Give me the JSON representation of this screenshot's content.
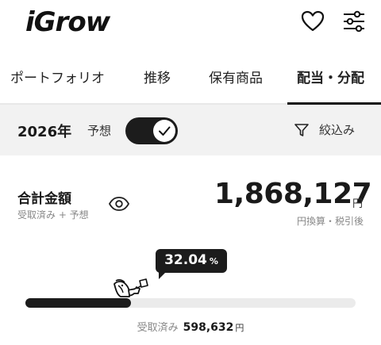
{
  "header": {
    "logo": "iGrow",
    "favorite_icon": "heart-icon",
    "settings_icon": "sliders-icon"
  },
  "tabs": [
    {
      "label": "ポートフォリオ",
      "active": false
    },
    {
      "label": "推移",
      "active": false
    },
    {
      "label": "保有商品",
      "active": false
    },
    {
      "label": "配当・分配",
      "active": true
    }
  ],
  "filterbar": {
    "year": "2026年",
    "forecast_label": "予想",
    "forecast_enabled": true,
    "filter_label": "絞込み",
    "filter_icon": "funnel-icon"
  },
  "total": {
    "title": "合計金額",
    "subtitle": "受取済み + 予想",
    "amount": "1,868,127",
    "unit": "円",
    "note": "円換算・税引後"
  },
  "progress": {
    "percent_text": "32.04",
    "percent_symbol": "%",
    "fraction": 0.3204,
    "received_label": "受取済み",
    "received_value": "598,632",
    "received_unit": "円"
  },
  "colors": {
    "accent": "#1c1c1c",
    "track": "#ebebeb",
    "filter_bg": "#f2f2f2"
  }
}
